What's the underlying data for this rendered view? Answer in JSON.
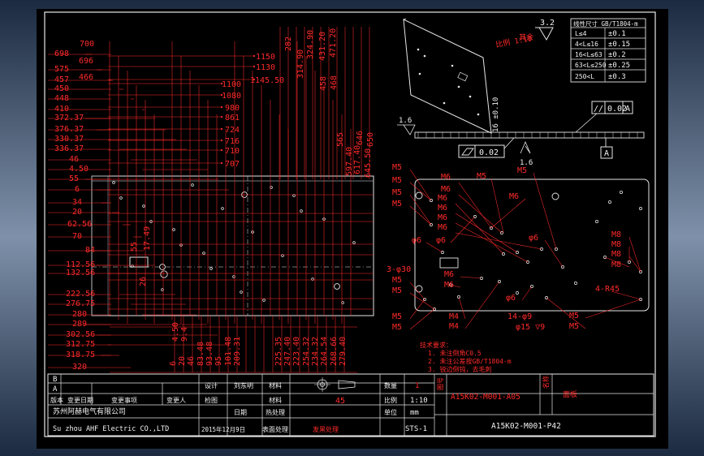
{
  "colors": {
    "background": "#000000",
    "dimension": "#ff2a2a",
    "geometry": "#f2f2f2",
    "titleblock": "#f2f2f2",
    "accent": "#38e8ff",
    "window_frame": "#7f91aa"
  },
  "left_dims": [
    "698",
    "575",
    "457",
    "450",
    "448",
    "410",
    "372.37",
    "376.37",
    "330.37",
    "336.37",
    "46",
    "4.50",
    "55",
    "6",
    "34",
    "20",
    "62.56",
    "70",
    "84",
    "112.56",
    "132.56",
    "222.56",
    "276.75",
    "280",
    "289",
    "302.56",
    "312.75",
    "318.75",
    "320"
  ],
  "left_dims_b": [
    "700",
    "696",
    "466"
  ],
  "mid_dims": [
    "1150",
    "1130",
    "1145.50",
    "1100",
    "1080",
    "980",
    "861",
    "724",
    "716",
    "710",
    "707"
  ],
  "top_vert": [
    "282",
    "314.90",
    "324.90",
    "431.20",
    "471.20",
    "458",
    "468",
    "565",
    "597.40",
    "617.40",
    "645.50",
    "646",
    "650"
  ],
  "bottom_dims": [
    "4.50",
    "9.4",
    "6",
    "20",
    "46",
    "83.48",
    "93.48",
    "95",
    "101.48",
    "209.31",
    "225.35",
    "247.40",
    "223.40",
    "254.32",
    "234.32",
    "264.54",
    "268.66",
    "279.40"
  ],
  "small_dims": [
    "55",
    "17.49",
    "26"
  ],
  "roughness": {
    "value": "3.2",
    "note": "其余",
    "scale_note": "比例 1:10"
  },
  "tolerance_table": {
    "title": "线性尺寸 GB/T1804-m",
    "rows": [
      [
        "L≤4",
        "±0.1"
      ],
      [
        "4<L≤16",
        "±0.15"
      ],
      [
        "16<L≤63",
        "±0.2"
      ],
      [
        "63<L≤250",
        "±0.25"
      ],
      [
        "250<L",
        "±0.3"
      ]
    ]
  },
  "gdt": {
    "parallel": "0.02",
    "datum": "A",
    "flatness": "0.02",
    "surface": "1.6",
    "thickness": "16 ±0.10"
  },
  "hole_labels": [
    "M5",
    "M5",
    "M5",
    "M5",
    "M5",
    "M5",
    "M6",
    "M6",
    "M6",
    "M6",
    "M6",
    "M6",
    "φ6",
    "φ6",
    "φ6",
    "M6",
    "M8",
    "M8",
    "M8",
    "M8",
    "M6",
    "M6",
    "M5",
    "M5",
    "M4",
    "M4",
    "φ6",
    "M5",
    "M5",
    "M5",
    "M5"
  ],
  "extra_labels": [
    "3-φ30",
    "4-R45",
    "14-φ9",
    "φ15 ▽9"
  ],
  "notes": [
    "技术要求：",
    "1. 未注倒角C0.5",
    "2. 未注公差按GB/T1804-m",
    "3. 锐边倒钝，去毛刺"
  ],
  "titleblock": {
    "rev_b": "B",
    "rev_a": "A",
    "rev_header": [
      "版本",
      "变更日期",
      "变更事项",
      "变更人"
    ],
    "company": "苏州阿赫电气有限公司",
    "company_en": "Su zhou AHF Electric CO.,LTD",
    "design_label": "设计",
    "design_by": "刘东明",
    "check_label": "检图",
    "date_label": "日期",
    "date": "2015年12月9日",
    "material_label": "材料",
    "material": "45",
    "heat_label": "热处理",
    "surface_label": "表面处理",
    "surface": "发黑处理",
    "qty_label": "数量",
    "qty": "1",
    "scale_label": "比例",
    "scale": "1:10",
    "unit_label": "单位",
    "unit": "mm",
    "sheet": "STS-1",
    "part_name": "面板",
    "drawing_no": "A15K02-M001-A05",
    "drawing_no2": "A15K02-M001-P42",
    "side_a": "图号",
    "side_b": "名称"
  }
}
